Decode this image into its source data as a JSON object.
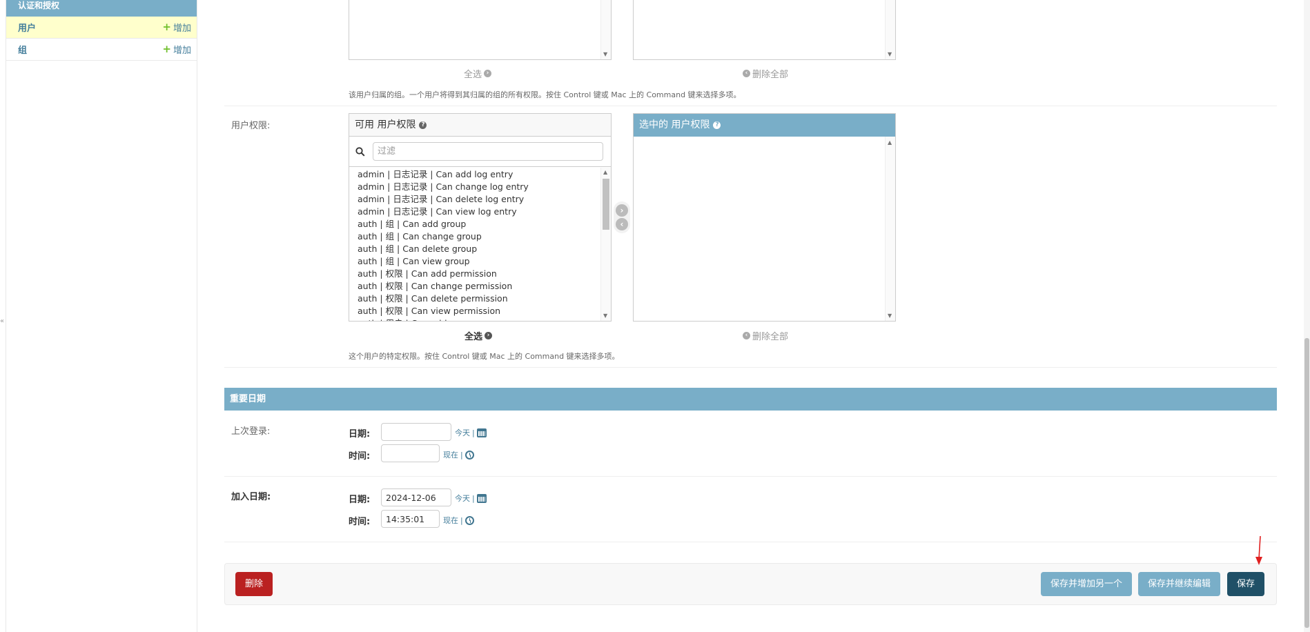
{
  "sidebar": {
    "module_title": "认证和授权",
    "items": [
      {
        "label": "用户",
        "add_label": "增加"
      },
      {
        "label": "组",
        "add_label": "增加"
      }
    ]
  },
  "groups": {
    "choose_all": "全选",
    "remove_all": "删除全部",
    "help": "该用户归属的组。一个用户将得到其归属的组的所有权限。按住 Control 键或 Mac 上的 Command 键来选择多项。"
  },
  "permissions": {
    "label": "用户权限:",
    "available_title": "可用 用户权限",
    "chosen_title": "选中的 用户权限",
    "filter_placeholder": "过滤",
    "options": [
      "admin | 日志记录 | Can add log entry",
      "admin | 日志记录 | Can change log entry",
      "admin | 日志记录 | Can delete log entry",
      "admin | 日志记录 | Can view log entry",
      "auth | 组 | Can add group",
      "auth | 组 | Can change group",
      "auth | 组 | Can delete group",
      "auth | 组 | Can view group",
      "auth | 权限 | Can add permission",
      "auth | 权限 | Can change permission",
      "auth | 权限 | Can delete permission",
      "auth | 权限 | Can view permission",
      "auth | 用户 | Can add user"
    ],
    "choose_all": "全选",
    "remove_all": "删除全部",
    "help": "这个用户的特定权限。按住 Control 键或 Mac 上的 Command 键来选择多项。"
  },
  "important_dates": {
    "title": "重要日期",
    "last_login": {
      "label": "上次登录:",
      "date_label": "日期:",
      "date_value": "",
      "today": "今天",
      "time_label": "时间:",
      "time_value": "",
      "now": "现在"
    },
    "date_joined": {
      "label": "加入日期:",
      "date_label": "日期:",
      "date_value": "2024-12-06",
      "today": "今天",
      "time_label": "时间:",
      "time_value": "14:35:01",
      "now": "现在"
    }
  },
  "submit": {
    "delete": "删除",
    "save_add_another": "保存并增加另一个",
    "save_continue": "保存并继续编辑",
    "save": "保存"
  },
  "colors": {
    "header_blue": "#79aec8",
    "primary": "#205067",
    "danger": "#ba2121",
    "link": "#447e9b"
  }
}
